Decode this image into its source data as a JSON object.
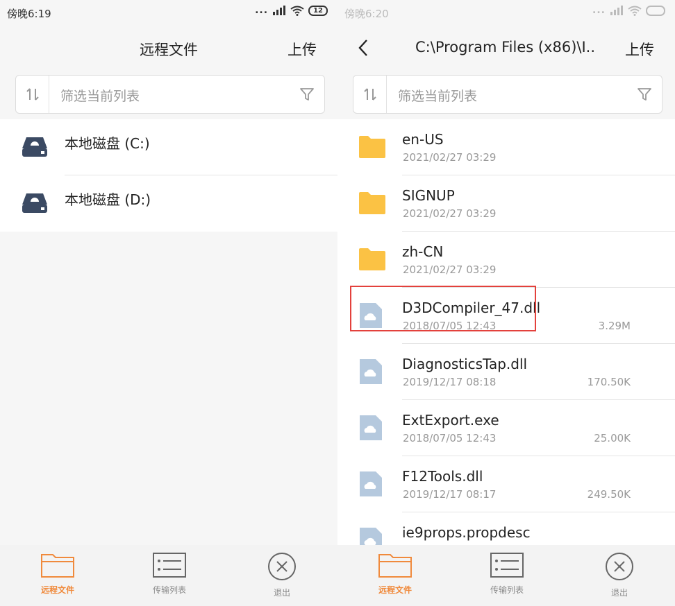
{
  "left": {
    "status": {
      "time": "傍晚6:19",
      "battery": "12"
    },
    "title": "远程文件",
    "upload_label": "上传",
    "filter": {
      "placeholder": "筛选当前列表"
    },
    "drives": [
      {
        "name": "本地磁盘 (C:)"
      },
      {
        "name": "本地磁盘 (D:)"
      }
    ],
    "tabs": [
      {
        "label": "远程文件"
      },
      {
        "label": "传输列表"
      },
      {
        "label": "退出"
      }
    ]
  },
  "right": {
    "status": {
      "time": "傍晚6:20"
    },
    "title": "C:\\Program Files (x86)\\I..",
    "upload_label": "上传",
    "filter": {
      "placeholder": "筛选当前列表"
    },
    "files": [
      {
        "name": "en-US",
        "date": "2021/02/27 03:29",
        "size": "",
        "type": "folder"
      },
      {
        "name": "SIGNUP",
        "date": "2021/02/27 03:29",
        "size": "",
        "type": "folder"
      },
      {
        "name": "zh-CN",
        "date": "2021/02/27 03:29",
        "size": "",
        "type": "folder"
      },
      {
        "name": "D3DCompiler_47.dll",
        "date": "2018/07/05 12:43",
        "size": "3.29M",
        "type": "file"
      },
      {
        "name": "DiagnosticsTap.dll",
        "date": "2019/12/17 08:18",
        "size": "170.50K",
        "type": "file"
      },
      {
        "name": "ExtExport.exe",
        "date": "2018/07/05 12:43",
        "size": "25.00K",
        "type": "file"
      },
      {
        "name": "F12Tools.dll",
        "date": "2019/12/17 08:17",
        "size": "249.50K",
        "type": "file"
      },
      {
        "name": "ie9props.propdesc",
        "date": "",
        "size": "",
        "type": "file"
      }
    ],
    "tabs": [
      {
        "label": "远程文件"
      },
      {
        "label": "传输列表"
      },
      {
        "label": "退出"
      }
    ]
  },
  "colors": {
    "accent": "#f08a3c",
    "folder": "#fbc244",
    "file": "#b5c9de",
    "drive": "#3b4a63",
    "highlight": "#e3413c"
  }
}
